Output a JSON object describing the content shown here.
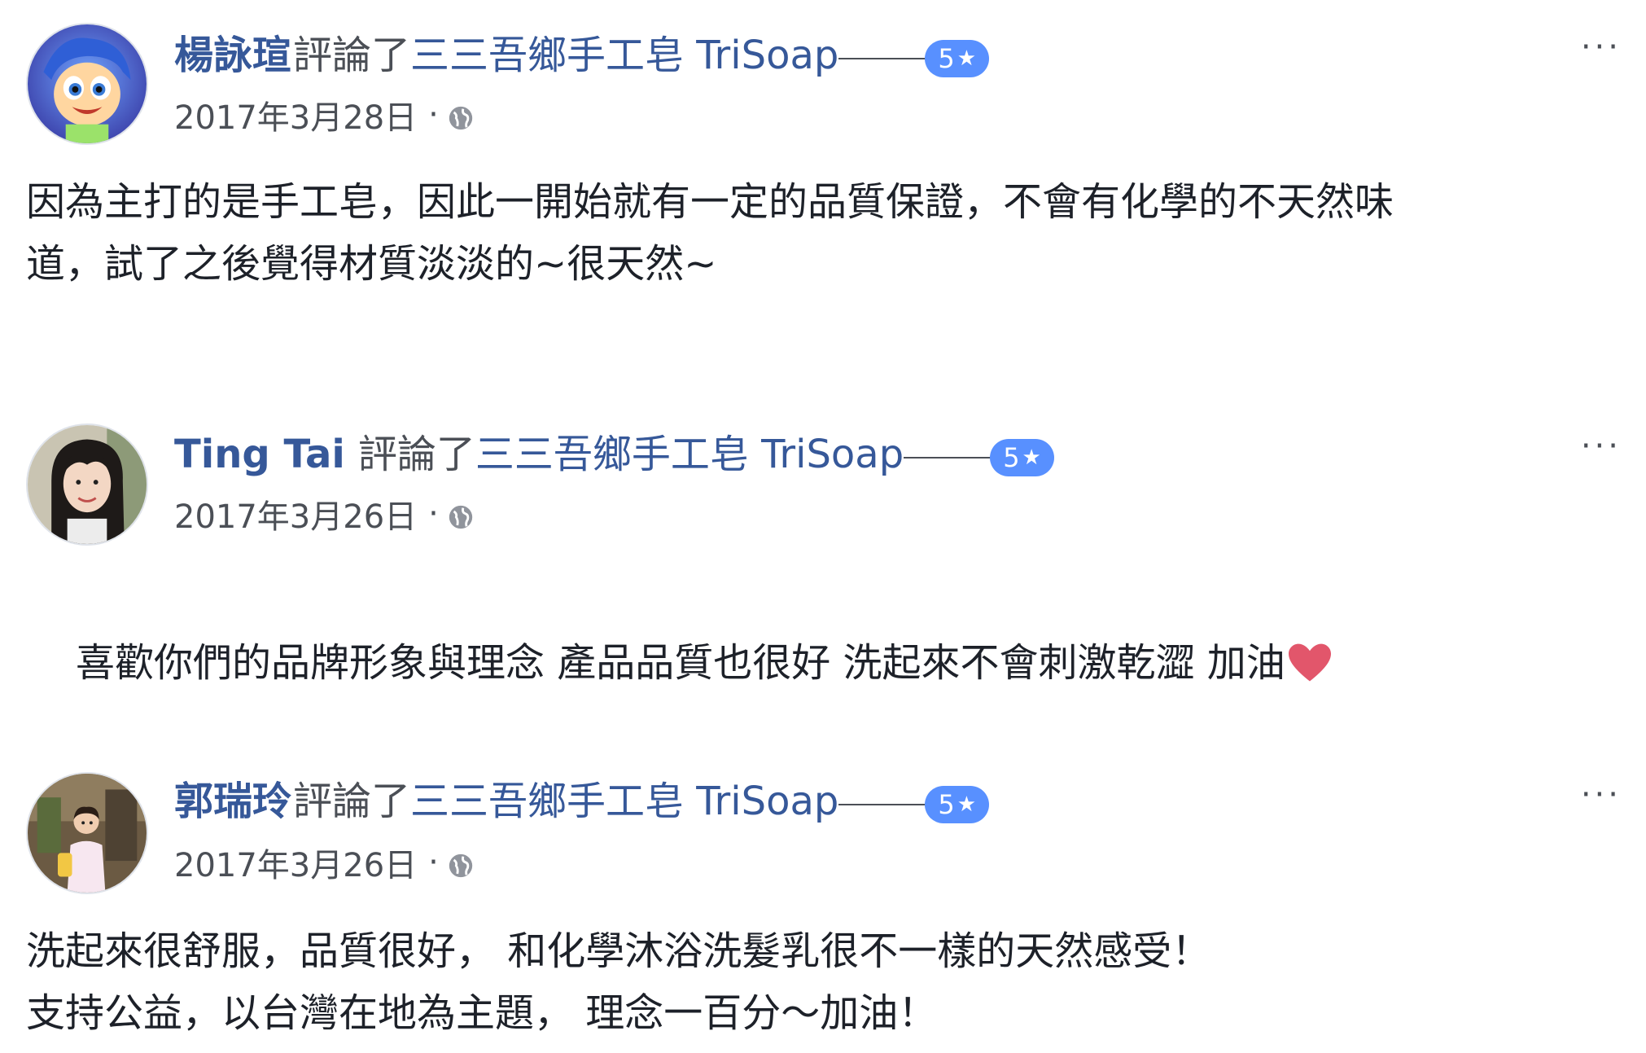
{
  "reviews": [
    {
      "name": "楊詠瑄",
      "action": "評論了",
      "page": "三三吾鄉手工皂 TriSoap",
      "rating": "5",
      "date": "2017年3月28日",
      "dot": "·",
      "more": "···",
      "text": "因為主打的是手工皂，因此一開始就有一定的品質保證，不會有化學的不天然味\n道，試了之後覺得材質淡淡的~很天然~",
      "avatar_icon": "cartoon-joy-avatar"
    },
    {
      "name": "Ting Tai",
      "action": "評論了",
      "page": "三三吾鄉手工皂 TriSoap",
      "rating": "5",
      "date": "2017年3月26日",
      "dot": "·",
      "more": "···",
      "text": "喜歡你們的品牌形象與理念 產品品質也很好 洗起來不會刺激乾澀 加油",
      "avatar_icon": "woman-portrait-avatar"
    },
    {
      "name": "郭瑞玲",
      "action": "評論了",
      "page": "三三吾鄉手工皂 TriSoap",
      "rating": "5",
      "date": "2017年3月26日",
      "dot": "·",
      "more": "···",
      "text": "洗起來很舒服，品質很好， 和化學沐浴洗髮乳很不一樣的天然感受！\n支持公益，以台灣在地為主題， 理念一百分～加油！",
      "avatar_icon": "woman-outdoor-avatar"
    }
  ],
  "colors": {
    "link": "#365899",
    "badge": "#5890ff",
    "text": "#1d2129",
    "meta": "#4b4f56",
    "heart": "#e2566b"
  }
}
